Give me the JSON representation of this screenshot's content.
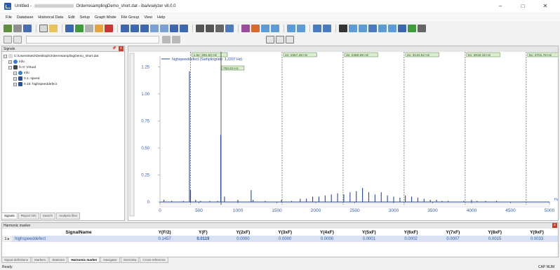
{
  "window": {
    "title_prefix": "Untitled -",
    "title_suffix": "OrderresamplingDemo_short.dat - ibaAnalyzer v8.0.0",
    "minimize": "–",
    "maximize": "□",
    "close": "✕"
  },
  "menu": [
    "File",
    "Database",
    "Historical Data",
    "Edit",
    "Setup",
    "Graph Mode",
    "File Group",
    "View",
    "Help"
  ],
  "signals_panel": {
    "title": "Signals",
    "pin": "📌",
    "close": "x",
    "tree": [
      {
        "label": "C:\\Users\\tsetz\\Desktop\\OrderresamplingDemo_short.dat",
        "indent": 0,
        "expander": "−",
        "icon": "file-icon"
      },
      {
        "label": "info",
        "indent": 1,
        "expander": "+",
        "icon": "info-icon"
      },
      {
        "label": "fx 0: Virtual",
        "indent": 1,
        "expander": "−",
        "icon": "fx-icon"
      },
      {
        "label": "info",
        "indent": 2,
        "expander": "+",
        "icon": "info-icon"
      },
      {
        "label": "0.1: speed",
        "indent": 2,
        "expander": "+",
        "icon": "wave-icon"
      },
      {
        "label": "0.15: highspeeddefect",
        "indent": 2,
        "expander": "+",
        "icon": "wave-icon"
      }
    ],
    "tabs": [
      "Signals",
      "Report info",
      "Search",
      "Analysis files"
    ]
  },
  "chart_data": {
    "type": "line",
    "legend": "highspeeddefect (Samplingrate: 1.2207 Hz)",
    "xlim": [
      0,
      5000
    ],
    "ylim": [
      0,
      1.35
    ],
    "x_ticks": [
      "0",
      "500",
      "1000",
      "1500",
      "2000",
      "2500",
      "3000",
      "3500",
      "4000",
      "4500",
      "5000"
    ],
    "y_ticks": [
      "0",
      "0.25",
      "0.50",
      "0.75",
      "1.00",
      "1.25"
    ],
    "x_unit": "Hz",
    "peaks": [
      {
        "x": 50,
        "y": 0.02
      },
      {
        "x": 150,
        "y": 0.01
      },
      {
        "x": 300,
        "y": 0.01
      },
      {
        "x": 378,
        "y": 1.21
      },
      {
        "x": 392,
        "y": 0.11
      },
      {
        "x": 458,
        "y": 0.02
      },
      {
        "x": 520,
        "y": 0.01
      },
      {
        "x": 640,
        "y": 0.01
      },
      {
        "x": 740,
        "y": 0.01
      },
      {
        "x": 780,
        "y": 0.62
      },
      {
        "x": 828,
        "y": 0.05
      },
      {
        "x": 1000,
        "y": 0.02
      },
      {
        "x": 1170,
        "y": 0.11
      },
      {
        "x": 1195,
        "y": 0.02
      },
      {
        "x": 1350,
        "y": 0.01
      },
      {
        "x": 1560,
        "y": 0.02
      },
      {
        "x": 1690,
        "y": 0.01
      },
      {
        "x": 1800,
        "y": 0.03
      },
      {
        "x": 1880,
        "y": 0.03
      },
      {
        "x": 1960,
        "y": 0.05
      },
      {
        "x": 2040,
        "y": 0.05
      },
      {
        "x": 2120,
        "y": 0.06
      },
      {
        "x": 2200,
        "y": 0.07
      },
      {
        "x": 2280,
        "y": 0.08
      },
      {
        "x": 2360,
        "y": 0.07
      },
      {
        "x": 2440,
        "y": 0.09
      },
      {
        "x": 2520,
        "y": 0.1
      },
      {
        "x": 2600,
        "y": 0.13
      },
      {
        "x": 2680,
        "y": 0.09
      },
      {
        "x": 2760,
        "y": 0.07
      },
      {
        "x": 2840,
        "y": 0.09
      },
      {
        "x": 2920,
        "y": 0.06
      },
      {
        "x": 3000,
        "y": 0.05
      },
      {
        "x": 3080,
        "y": 0.04
      },
      {
        "x": 3150,
        "y": 0.06
      },
      {
        "x": 3230,
        "y": 0.05
      },
      {
        "x": 3310,
        "y": 0.04
      },
      {
        "x": 3390,
        "y": 0.03
      },
      {
        "x": 3470,
        "y": 0.02
      },
      {
        "x": 3550,
        "y": 0.02
      },
      {
        "x": 3620,
        "y": 0.01
      },
      {
        "x": 3700,
        "y": 0.01
      },
      {
        "x": 3900,
        "y": 0.01
      },
      {
        "x": 4000,
        "y": 0.02
      },
      {
        "x": 4070,
        "y": 0.01
      },
      {
        "x": 4180,
        "y": 0.01
      },
      {
        "x": 4320,
        "y": 0.01
      }
    ],
    "markers": [
      {
        "label": "1.5x: 391.50 Hz",
        "x": 391.5,
        "style": "dashed"
      },
      {
        "label": "783.63 Hz",
        "x": 783.63,
        "style": "solid"
      },
      {
        "label": "2x: 1567.26 Hz",
        "x": 1567.26,
        "style": "dashed"
      },
      {
        "label": "3x: 2350.89 Hz",
        "x": 2350.89,
        "style": "dashed"
      },
      {
        "label": "4x: 3134.52 Hz",
        "x": 3134.52,
        "style": "dashed"
      },
      {
        "label": "5x: 3918.15 Hz",
        "x": 3918.15,
        "style": "dashed"
      },
      {
        "label": "6x: 4701.78 Hz",
        "x": 4701.78,
        "style": "dashed"
      }
    ]
  },
  "harmonic": {
    "title": "Harmonic marker",
    "close": "x",
    "columns": [
      "SignalName",
      "Y(F/2)",
      "Y(F)",
      "Y(2xF)",
      "Y(3xF)",
      "Y(4xF)",
      "Y(5xF)",
      "Y(6xF)",
      "Y(7xF)",
      "Y(8xF)",
      "Y(9xF)"
    ],
    "rows": [
      {
        "index": "1 ▸",
        "name": "highspeeddefect",
        "values": [
          "0.1457",
          "0.0119",
          "0.0000",
          "0.0000",
          "0.0000",
          "0.0001",
          "0.0002",
          "0.0007",
          "0.0015",
          "0.0033"
        ]
      }
    ]
  },
  "bottom_tabs": [
    "Signal definitions",
    "Markers",
    "Statistics",
    "Harmonic marker",
    "Navigator",
    "Overview",
    "Cross-reference"
  ],
  "status": {
    "left": "Ready",
    "right": "CAP NUM"
  },
  "colors": {
    "series": "#2846a8",
    "marker": "#333333",
    "label_bg": "#dcedd2",
    "label_border": "#4a7a3a"
  }
}
